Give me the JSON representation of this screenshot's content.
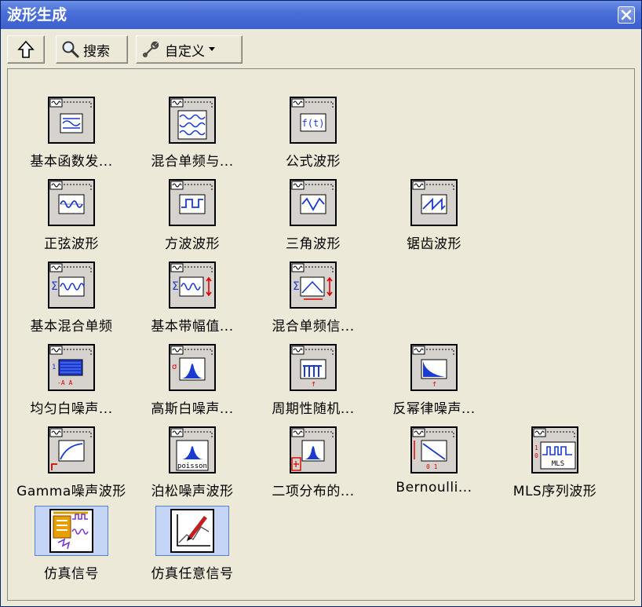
{
  "window": {
    "title": "波形生成"
  },
  "toolbar": {
    "up_icon": "up-arrow-icon",
    "search_label": "搜索",
    "customize_label": "自定义"
  },
  "items": [
    {
      "label": "基本函数发...",
      "icon": "basic-function-generator-icon"
    },
    {
      "label": "混合单频与...",
      "icon": "mixed-single-tone-icon"
    },
    {
      "label": "公式波形",
      "icon": "formula-waveform-icon"
    },
    {
      "label": "正弦波形",
      "icon": "sine-waveform-icon"
    },
    {
      "label": "方波波形",
      "icon": "square-waveform-icon"
    },
    {
      "label": "三角波形",
      "icon": "triangle-waveform-icon"
    },
    {
      "label": "锯齿波形",
      "icon": "sawtooth-waveform-icon"
    },
    {
      "label": "基本混合单频",
      "icon": "basic-multitone-icon"
    },
    {
      "label": "基本带幅值...",
      "icon": "basic-multitone-amplitude-icon"
    },
    {
      "label": "混合单频信...",
      "icon": "multitone-signal-icon"
    },
    {
      "label": "均匀白噪声...",
      "icon": "uniform-white-noise-icon"
    },
    {
      "label": "高斯白噪声...",
      "icon": "gaussian-white-noise-icon"
    },
    {
      "label": "周期性随机...",
      "icon": "periodic-random-noise-icon"
    },
    {
      "label": "反幂律噪声...",
      "icon": "inverse-power-noise-icon"
    },
    {
      "label": "Gamma噪声波形",
      "icon": "gamma-noise-icon"
    },
    {
      "label": "泊松噪声波形",
      "icon": "poisson-noise-icon"
    },
    {
      "label": "二项分布的...",
      "icon": "binomial-noise-icon"
    },
    {
      "label": "Bernoulli...",
      "icon": "bernoulli-noise-icon"
    },
    {
      "label": "MLS序列波形",
      "icon": "mls-sequence-icon"
    },
    {
      "label": "仿真信号",
      "icon": "simulate-signal-icon"
    },
    {
      "label": "仿真任意信号",
      "icon": "simulate-arbitrary-signal-icon"
    }
  ],
  "icon_text": {
    "formula": "f(t)",
    "poisson": "poisson",
    "mls": "MLS"
  }
}
